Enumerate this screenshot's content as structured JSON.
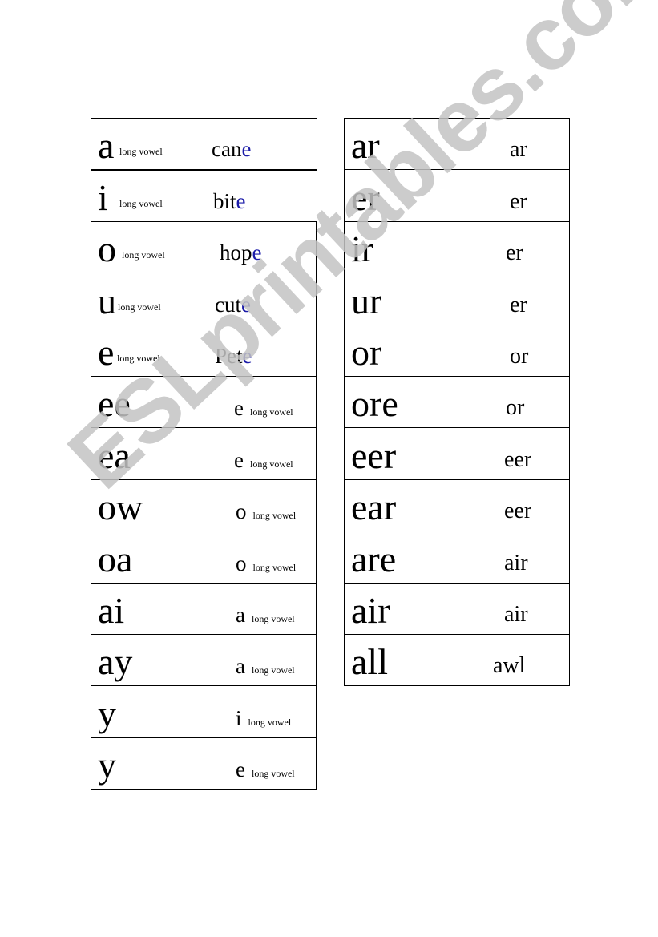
{
  "watermark": "ESLprintables.com",
  "colors": {
    "highlight_blue": "#1a1aa8",
    "watermark_gray": "#c4c4c4"
  },
  "left_cards": [
    {
      "spelling": "a",
      "note": "long vowel",
      "example_stem": "can",
      "example_highlight": "e"
    },
    {
      "spelling": "i",
      "note": "long vowel",
      "example_stem": "bit",
      "example_highlight": "e"
    },
    {
      "spelling": "o",
      "note": "long vowel",
      "example_stem": "hop",
      "example_highlight": "e"
    },
    {
      "spelling": "u",
      "note": "long vowel",
      "example_stem": "cut",
      "example_highlight": "e"
    },
    {
      "spelling": "e",
      "note": "long vowel",
      "example_stem": "Pet",
      "example_highlight": "e"
    },
    {
      "spelling": "ee",
      "sound": "e",
      "note": "long vowel"
    },
    {
      "spelling": "ea",
      "sound": "e",
      "note": "long vowel"
    },
    {
      "spelling": "ow",
      "sound": "o",
      "note": "long vowel"
    },
    {
      "spelling": "oa",
      "sound": "o",
      "note": "long vowel"
    },
    {
      "spelling": "ai",
      "sound": "a",
      "note": "long vowel"
    },
    {
      "spelling": "ay",
      "sound": "a",
      "note": "long vowel"
    },
    {
      "spelling": "y",
      "sound": "i",
      "note": "long vowel"
    },
    {
      "spelling": "y",
      "sound": "e",
      "note": "long vowel"
    }
  ],
  "right_cards": [
    {
      "spelling": "ar",
      "sound": "ar"
    },
    {
      "spelling": "er",
      "sound": "er"
    },
    {
      "spelling": "ir",
      "sound": "er"
    },
    {
      "spelling": "ur",
      "sound": "er"
    },
    {
      "spelling": "or",
      "sound": "or"
    },
    {
      "spelling": "ore",
      "sound": "or"
    },
    {
      "spelling": "eer",
      "sound": "eer"
    },
    {
      "spelling": "ear",
      "sound": "eer"
    },
    {
      "spelling": "are",
      "sound": "air"
    },
    {
      "spelling": "air",
      "sound": "air"
    },
    {
      "spelling": "all",
      "sound": "awl"
    }
  ]
}
